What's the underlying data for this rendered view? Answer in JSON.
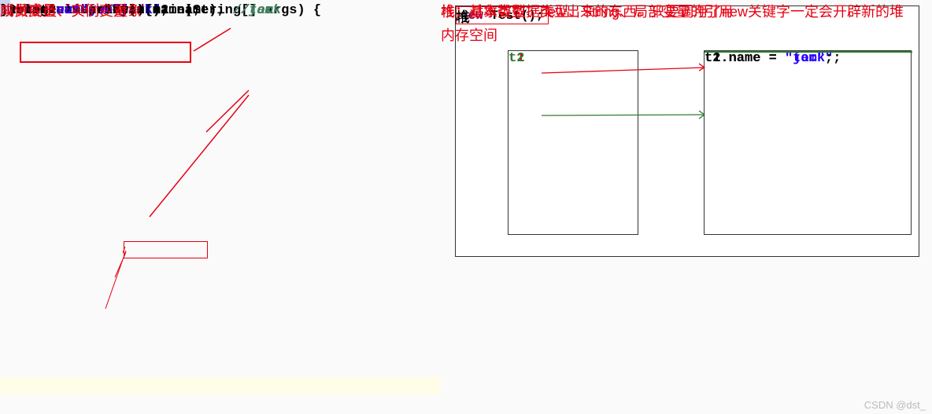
{
  "code": {
    "l1_pre": "public class",
    "l1_cls": " Test {",
    "l2_type": "String ",
    "l2_name": "name; ",
    "l2_cmt": "// null",
    "l3": "public void ",
    "l3_fn": "show",
    "l3_after": "(){",
    "l4": "String name = ",
    "l4_str": "\"jack\"",
    "l4_semi": ";",
    "l5a": "System.",
    "l5out": "out",
    "l5b": ".println(name);",
    "l6": "}",
    "l7": "public static void ",
    "l7_fn": "main",
    "l7_after": "(String[] args) ",
    "l7_brace": "{",
    "l8": "Test t1 = ",
    "l8_new": "new",
    "l8_after": " Test();",
    "l9": "t1.name = ",
    "l9_str": "\"jack\"",
    "l9_semi": ";",
    "l10": "Test t2 = ",
    "l10_new": "new",
    "l10_after": " Test();",
    "l11": "t2.name = ",
    "l11_str": "\"tom\"",
    "l11_semi": ";",
    "l12a": "System.",
    "l12out": "out",
    "l12b": ".println(t1.name); ",
    "l12_cmt": "//jack",
    "l13a": "System.",
    "l13out": "out",
    "l13b": ".println(t2.name); ",
    "l13_cmt": "//tom",
    "l14": "}"
  },
  "anno": {
    "a1": "成员变量、实例变量",
    "a2": "叫做成员、实例、对象"
  },
  "diagram": {
    "top_new": "new",
    "top_after": " Test();",
    "stack_label": "栈",
    "heap_label": "堆",
    "t1": "t1",
    "t2": "t2",
    "h1a": "t1.name = ",
    "h1_str": "\"jack\"",
    "h1_semi": ";",
    "h2a": "t2.name = ",
    "h2_str": "\"tom\"",
    "h2_semi": ";"
  },
  "notes": {
    "n1": "栈：基本数数据类型、String、局部变量的引用",
    "n2": "堆：对象类型、new出来的东西。只要调用了new关键字一定会开辟新的堆内存空间"
  },
  "watermark": "CSDN @dst_"
}
